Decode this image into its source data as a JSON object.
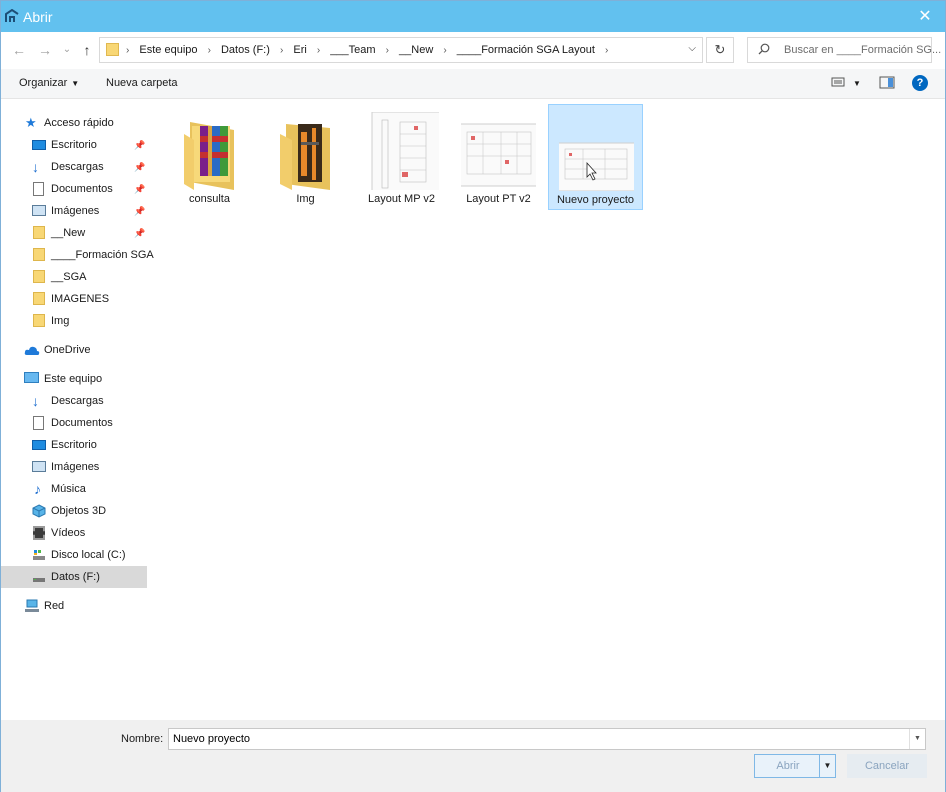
{
  "window": {
    "title": "Abrir",
    "close_glyph": "✕"
  },
  "nav": {
    "back_glyph": "←",
    "forward_glyph": "→",
    "recent_glyph": "⌄",
    "up_glyph": "↑",
    "breadcrumb": [
      "Este equipo",
      "Datos (F:)",
      "Eri",
      "___Team",
      "__New",
      "____Formación SGA Layout"
    ],
    "refresh_glyph": "↻",
    "search_placeholder": "Buscar en ____Formación SG..."
  },
  "toolbar": {
    "organize_label": "Organizar",
    "new_folder_label": "Nueva carpeta",
    "help_glyph": "?"
  },
  "sidebar": {
    "quick_access": "Acceso rápido",
    "quick_items": [
      {
        "label": "Escritorio",
        "icon": "desktop-icon",
        "pinned": true
      },
      {
        "label": "Descargas",
        "icon": "download-icon",
        "pinned": true
      },
      {
        "label": "Documentos",
        "icon": "document-icon",
        "pinned": true
      },
      {
        "label": "Imágenes",
        "icon": "pictures-icon",
        "pinned": true
      },
      {
        "label": "__New",
        "icon": "folder-icon",
        "pinned": true
      },
      {
        "label": "____Formación SGA",
        "icon": "folder-icon",
        "pinned": false
      },
      {
        "label": "__SGA",
        "icon": "folder-icon",
        "pinned": false
      },
      {
        "label": "IMAGENES",
        "icon": "folder-icon",
        "pinned": false
      },
      {
        "label": "Img",
        "icon": "folder-icon",
        "pinned": false
      }
    ],
    "onedrive": "OneDrive",
    "this_pc": "Este equipo",
    "pc_items": [
      {
        "label": "Descargas",
        "icon": "download-icon"
      },
      {
        "label": "Documentos",
        "icon": "document-icon"
      },
      {
        "label": "Escritorio",
        "icon": "desktop-icon"
      },
      {
        "label": "Imágenes",
        "icon": "pictures-icon"
      },
      {
        "label": "Música",
        "icon": "music-icon"
      },
      {
        "label": "Objetos 3D",
        "icon": "3d-objects-icon"
      },
      {
        "label": "Vídeos",
        "icon": "video-icon"
      },
      {
        "label": "Disco local (C:)",
        "icon": "drive-c-icon"
      },
      {
        "label": "Datos (F:)",
        "icon": "drive-f-icon",
        "selected": true
      }
    ],
    "network": "Red",
    "pin_glyph": "📌"
  },
  "files": [
    {
      "name": "consulta",
      "type": "archive-folder"
    },
    {
      "name": "Img",
      "type": "image-folder"
    },
    {
      "name": "Layout MP v2",
      "type": "layout-document"
    },
    {
      "name": "Layout PT v2",
      "type": "layout-document"
    },
    {
      "name": "Nuevo proyecto",
      "type": "layout-document",
      "selected": true
    }
  ],
  "footer": {
    "name_label": "Nombre:",
    "name_value": "Nuevo proyecto",
    "open_label": "Abrir",
    "cancel_label": "Cancelar"
  },
  "colors": {
    "titlebar": "#62c1ef",
    "selection": "#cce8ff",
    "accent": "#0067c0"
  }
}
